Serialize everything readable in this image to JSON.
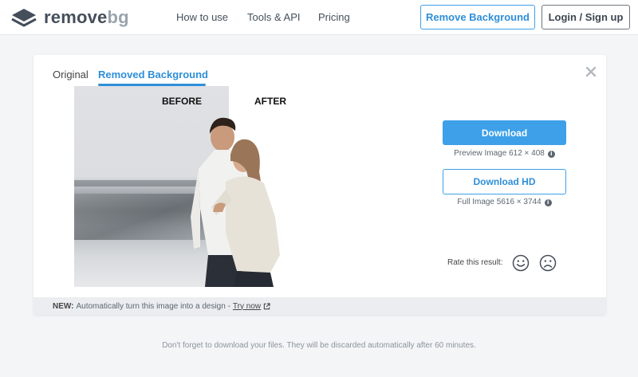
{
  "header": {
    "logo": {
      "part1": "remove",
      "part2": "bg",
      "icon": "layers-icon"
    },
    "nav": [
      "How to use",
      "Tools & API",
      "Pricing"
    ],
    "remove_background_label": "Remove Background",
    "login_label": "Login / Sign up"
  },
  "card": {
    "tabs": [
      {
        "label": "Original",
        "active": false
      },
      {
        "label": "Removed Background",
        "active": true
      }
    ],
    "close_icon": "close-icon",
    "compare": {
      "before_label": "BEFORE",
      "after_label": "AFTER"
    },
    "download": {
      "label": "Download",
      "info": "Preview Image 612 × 408"
    },
    "download_hd": {
      "label": "Download HD",
      "info": "Full Image 5616 × 3744"
    },
    "info_icon_glyph": "i",
    "rating": {
      "label": "Rate this result:",
      "options": [
        "smile-icon",
        "frown-icon"
      ]
    },
    "footer": {
      "new_label": "NEW:",
      "text": "Automatically turn this image into a design -",
      "link": "Try now"
    }
  },
  "page_note": "Don't forget to download your files. They will be discarded automatically after 60 minutes.",
  "colors": {
    "accent": "#3da0e8",
    "accent_text": "#2e8fd9",
    "page_bg": "#f4f5f7"
  }
}
